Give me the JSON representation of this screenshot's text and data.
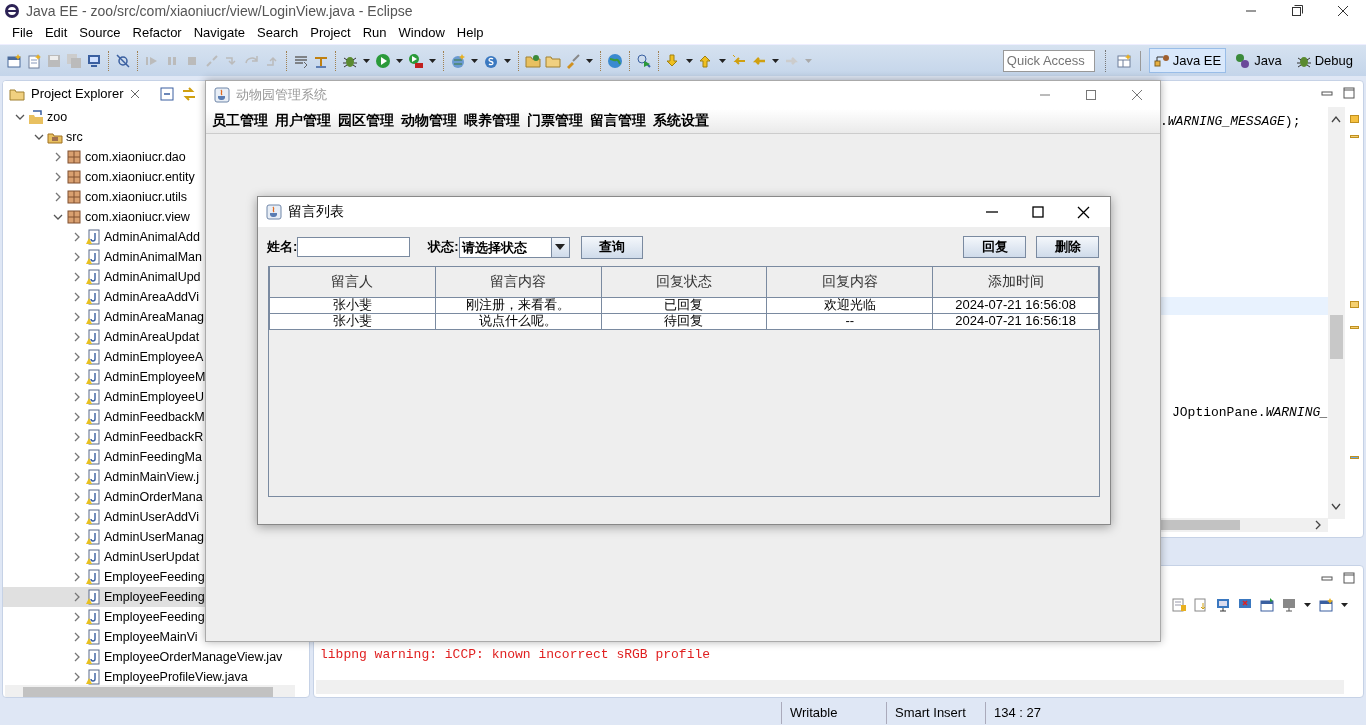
{
  "window": {
    "title": "Java EE - zoo/src/com/xiaoniucr/view/LoginView.java - Eclipse"
  },
  "menu": [
    "File",
    "Edit",
    "Source",
    "Refactor",
    "Navigate",
    "Search",
    "Project",
    "Run",
    "Window",
    "Help"
  ],
  "quick_access": {
    "placeholder": "Quick Access"
  },
  "perspectives": [
    {
      "label": "Java EE",
      "selected": true
    },
    {
      "label": "Java",
      "selected": false
    },
    {
      "label": "Debug",
      "selected": false
    }
  ],
  "project_explorer": {
    "title": "Project Explorer",
    "tree": [
      {
        "label": "zoo",
        "kind": "project",
        "expanded": true,
        "selected": false,
        "children": [
          {
            "label": "src",
            "kind": "source",
            "expanded": true,
            "selected": false,
            "children": [
              {
                "label": "com.xiaoniucr.dao",
                "kind": "package",
                "expanded": false,
                "selected": false
              },
              {
                "label": "com.xiaoniucr.entity",
                "kind": "package",
                "expanded": false,
                "selected": false
              },
              {
                "label": "com.xiaoniucr.utils",
                "kind": "package",
                "expanded": false,
                "selected": false
              },
              {
                "label": "com.xiaoniucr.view",
                "kind": "package",
                "expanded": true,
                "selected": false,
                "children": [
                  {
                    "label": "AdminAnimalAdd",
                    "kind": "file",
                    "expanded": false,
                    "selected": false
                  },
                  {
                    "label": "AdminAnimalMan",
                    "kind": "file",
                    "expanded": false,
                    "selected": false
                  },
                  {
                    "label": "AdminAnimalUpd",
                    "kind": "file",
                    "expanded": false,
                    "selected": false
                  },
                  {
                    "label": "AdminAreaAddVi",
                    "kind": "file",
                    "expanded": false,
                    "selected": false
                  },
                  {
                    "label": "AdminAreaManag",
                    "kind": "file",
                    "expanded": false,
                    "selected": false
                  },
                  {
                    "label": "AdminAreaUpdat",
                    "kind": "file",
                    "expanded": false,
                    "selected": false
                  },
                  {
                    "label": "AdminEmployeeA",
                    "kind": "file",
                    "expanded": false,
                    "selected": false
                  },
                  {
                    "label": "AdminEmployeeM",
                    "kind": "file",
                    "expanded": false,
                    "selected": false
                  },
                  {
                    "label": "AdminEmployeeU",
                    "kind": "file",
                    "expanded": false,
                    "selected": false
                  },
                  {
                    "label": "AdminFeedbackM",
                    "kind": "file",
                    "expanded": false,
                    "selected": false
                  },
                  {
                    "label": "AdminFeedbackR",
                    "kind": "file",
                    "expanded": false,
                    "selected": false
                  },
                  {
                    "label": "AdminFeedingMa",
                    "kind": "file",
                    "expanded": false,
                    "selected": false
                  },
                  {
                    "label": "AdminMainView.j",
                    "kind": "file",
                    "expanded": false,
                    "selected": false
                  },
                  {
                    "label": "AdminOrderMana",
                    "kind": "file",
                    "expanded": false,
                    "selected": false
                  },
                  {
                    "label": "AdminUserAddVi",
                    "kind": "file",
                    "expanded": false,
                    "selected": false
                  },
                  {
                    "label": "AdminUserManag",
                    "kind": "file",
                    "expanded": false,
                    "selected": false
                  },
                  {
                    "label": "AdminUserUpdat",
                    "kind": "file",
                    "expanded": false,
                    "selected": false
                  },
                  {
                    "label": "EmployeeFeeding",
                    "kind": "file",
                    "expanded": false,
                    "selected": false
                  },
                  {
                    "label": "EmployeeFeeding",
                    "kind": "file",
                    "expanded": false,
                    "selected": true
                  },
                  {
                    "label": "EmployeeFeeding",
                    "kind": "file",
                    "expanded": false,
                    "selected": false
                  },
                  {
                    "label": "EmployeeMainVi",
                    "kind": "file",
                    "expanded": false,
                    "selected": false
                  },
                  {
                    "label": "EmployeeOrderManageView.jav",
                    "kind": "file",
                    "expanded": false,
                    "selected": false
                  },
                  {
                    "label": "EmployeeProfileView.java",
                    "kind": "file",
                    "expanded": false,
                    "selected": false
                  }
                ]
              }
            ]
          }
        ]
      }
    ]
  },
  "editor": {
    "lines": [
      ".*WARNING_MESSAGE*);",
      "JOptionPane.*WARNING_*"
    ]
  },
  "console": {
    "lines": [
      {
        "text": "libpng warning: iCCP: known incorrect sRGB profile",
        "kind": "error"
      }
    ]
  },
  "status_bar": [
    "Writable",
    "Smart Insert",
    "134 : 27"
  ],
  "app": {
    "title": "动物园管理系统",
    "menu": [
      "员工管理",
      "用户管理",
      "园区管理",
      "动物管理",
      "喂养管理",
      "门票管理",
      "留言管理",
      "系统设置"
    ],
    "dialog": {
      "title": "留言列表",
      "name_label": "姓名:",
      "status_label": "状态:",
      "status_select": "请选择状态",
      "query_button": "查询",
      "actions": [
        "回复",
        "删除"
      ],
      "table": {
        "columns": [
          "留言人",
          "留言内容",
          "回复状态",
          "回复内容",
          "添加时间"
        ],
        "rows": [
          [
            "张小斐",
            "刚注册，来看看。",
            "已回复",
            "欢迎光临",
            "2024-07-21 16:56:08"
          ],
          [
            "张小斐",
            "说点什么呢。",
            "待回复",
            "--",
            "2024-07-21 16:56:18"
          ]
        ]
      }
    }
  }
}
